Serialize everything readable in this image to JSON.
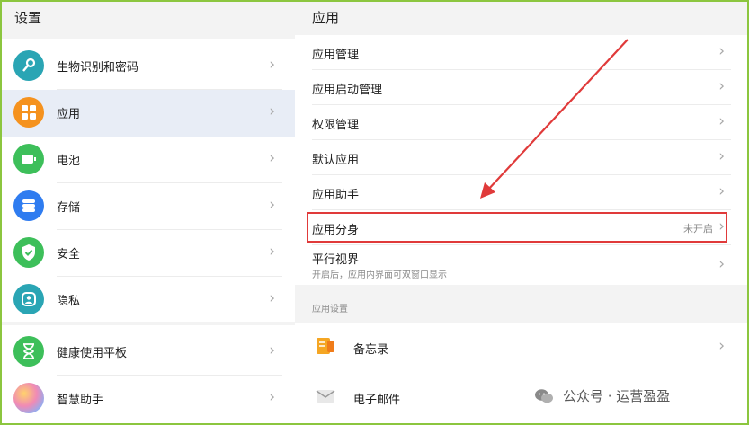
{
  "left": {
    "title": "设置",
    "items": [
      {
        "label": "生物识别和密码",
        "icon": "key-icon",
        "color": "#2aa5b4"
      },
      {
        "label": "应用",
        "icon": "apps-grid-icon",
        "color": "#f5921e",
        "selected": true
      },
      {
        "label": "电池",
        "icon": "battery-icon",
        "color": "#3dbf5a"
      },
      {
        "label": "存储",
        "icon": "storage-icon",
        "color": "#2f7cf0"
      },
      {
        "label": "安全",
        "icon": "shield-icon",
        "color": "#3dbf5a"
      },
      {
        "label": "隐私",
        "icon": "privacy-icon",
        "color": "#2aa5b4"
      }
    ],
    "items2": [
      {
        "label": "健康使用平板",
        "icon": "hourglass-icon",
        "color": "#3dbf5a"
      },
      {
        "label": "智慧助手",
        "icon": "assistant-icon",
        "color": "#b98ae6"
      }
    ]
  },
  "right": {
    "title": "应用",
    "items": [
      {
        "label": "应用管理"
      },
      {
        "label": "应用启动管理"
      },
      {
        "label": "权限管理"
      },
      {
        "label": "默认应用"
      },
      {
        "label": "应用助手"
      },
      {
        "label": "应用分身",
        "status": "未开启"
      },
      {
        "label": "平行视界",
        "sub": "开启后，应用内界面可双窗口显示"
      }
    ],
    "section_label": "应用设置",
    "apps": [
      {
        "label": "备忘录",
        "icon": "memo-icon"
      },
      {
        "label": "电子邮件",
        "icon": "email-icon"
      }
    ]
  },
  "watermark": {
    "text": "公众号 · 运营盈盈",
    "icon": "wechat-icon"
  },
  "colors": {
    "accent": "#e03a3a",
    "border": "#8cc63f",
    "selected_bg": "#e8edf6"
  }
}
